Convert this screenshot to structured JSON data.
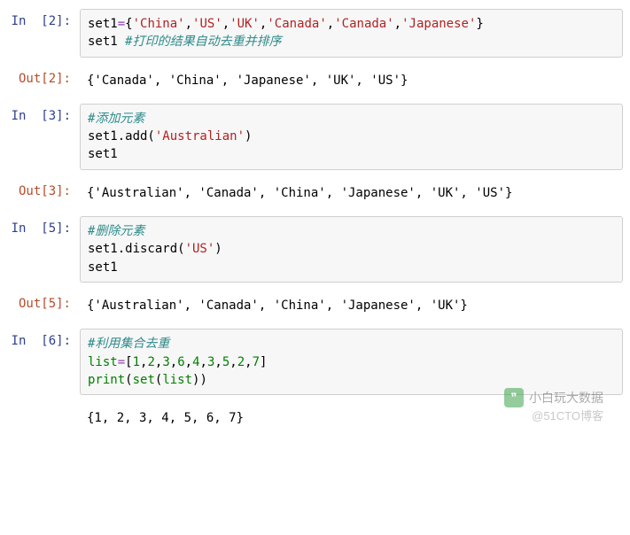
{
  "cells": [
    {
      "prompt_in": "In  [2]:",
      "code": {
        "line1_var": "set1",
        "line1_eq": "=",
        "line1_open": "{",
        "line1_s1": "'China'",
        "line1_s2": "'US'",
        "line1_s3": "'UK'",
        "line1_s4": "'Canada'",
        "line1_s5": "'Canada'",
        "line1_s6": "'Japanese'",
        "line1_close": "}",
        "line2_var": "set1 ",
        "line2_comment": "#打印的结果自动去重并排序"
      },
      "prompt_out": "Out[2]:",
      "output": "{'Canada', 'China', 'Japanese', 'UK', 'US'}"
    },
    {
      "prompt_in": "In  [3]:",
      "code": {
        "line1_comment": "#添加元素",
        "line2_pre": "set1.add(",
        "line2_str": "'Australian'",
        "line2_post": ")",
        "line3": "set1"
      },
      "prompt_out": "Out[3]:",
      "output": "{'Australian', 'Canada', 'China', 'Japanese', 'UK', 'US'}"
    },
    {
      "prompt_in": "In  [5]:",
      "code": {
        "line1_comment": "#删除元素",
        "line2_pre": "set1.discard(",
        "line2_str": "'US'",
        "line2_post": ")",
        "line3": "set1"
      },
      "prompt_out": "Out[5]:",
      "output": "{'Australian', 'Canada', 'China', 'Japanese', 'UK'}"
    },
    {
      "prompt_in": "In  [6]:",
      "code": {
        "line1_comment": "#利用集合去重",
        "line2_var": "list",
        "line2_eq": "=",
        "line2_open": "[",
        "line2_n1": "1",
        "line2_n2": "2",
        "line2_n3": "3",
        "line2_n4": "6",
        "line2_n5": "4",
        "line2_n6": "3",
        "line2_n7": "5",
        "line2_n8": "2",
        "line2_n9": "7",
        "line2_close": "]",
        "line3_a": "print",
        "line3_b": "(",
        "line3_c": "set",
        "line3_d": "(",
        "line3_e": "list",
        "line3_f": "))"
      },
      "prompt_out": "",
      "output": "{1, 2, 3, 4, 5, 6, 7}"
    }
  ],
  "watermark_main": "小白玩大数据",
  "watermark_sub": "@51CTO博客"
}
